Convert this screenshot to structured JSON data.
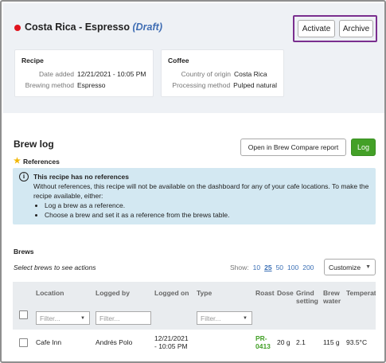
{
  "header": {
    "title": "Costa Rica - Espresso",
    "draft_label": "(Draft)",
    "status_color": "#e0141e",
    "activate_label": "Activate",
    "archive_label": "Archive"
  },
  "recipe_card": {
    "title": "Recipe",
    "date_label": "Date added",
    "date_value": "12/21/2021 - 10:05 PM",
    "method_label": "Brewing method",
    "method_value": "Espresso"
  },
  "coffee_card": {
    "title": "Coffee",
    "origin_label": "Country of origin",
    "origin_value": "Costa Rica",
    "processing_label": "Processing method",
    "processing_value": "Pulped natural"
  },
  "brew_log": {
    "title": "Brew log",
    "compare_label": "Open in Brew Compare report",
    "log_label": "Log",
    "references_label": "References",
    "info_title": "This recipe has no references",
    "info_text": "Without references, this recipe will not be available on the dashboard for any of your cafe locations. To make the recipe available, either:",
    "info_items": [
      "Log a brew as a reference.",
      "Choose a brew and set it as a reference from the brews table."
    ]
  },
  "brews": {
    "title": "Brews",
    "select_hint": "Select brews to see actions",
    "show_label": "Show:",
    "page_sizes": [
      "10",
      "25",
      "50",
      "100",
      "200"
    ],
    "active_page_size": "25",
    "customize_label": "Customize",
    "columns": [
      "Location",
      "Logged by",
      "Logged on",
      "Type",
      "Roast",
      "Dose",
      "Grind setting",
      "Brew water",
      "Temperatu"
    ],
    "filter_placeholder": "Filter...",
    "rows": [
      {
        "location": "Cafe Inn",
        "logged_by": "Andrés Polo",
        "logged_on_1": "12/21/2021",
        "logged_on_2": "- 10:05 PM",
        "roast_1": "PR-",
        "roast_2": "0413",
        "dose": "20 g",
        "grind": "2.1",
        "water": "115 g",
        "temp": "93.5°C"
      }
    ]
  },
  "colors": {
    "accent_green": "#43a027",
    "link_blue": "#3a6fb5",
    "highlight": "#7a2f8f",
    "info_bg": "#d3e8f2"
  }
}
